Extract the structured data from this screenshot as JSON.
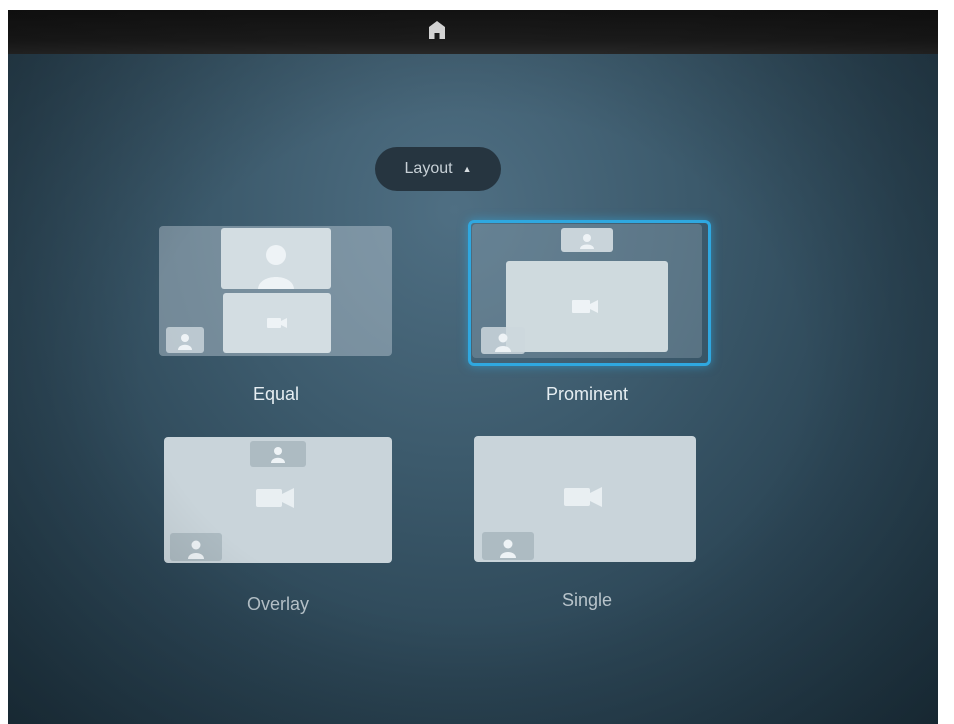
{
  "topbar": {
    "home_icon": "home-icon"
  },
  "layout_menu": {
    "label": "Layout",
    "caret_icon": "caret-up-icon"
  },
  "options": [
    {
      "label": "Equal"
    },
    {
      "label": "Prominent",
      "selected": true
    },
    {
      "label": "Overlay"
    },
    {
      "label": "Single"
    }
  ],
  "colors": {
    "selection": "#2fa8e0",
    "pill_bg": "#263540",
    "thumb": "#c9d4da"
  }
}
